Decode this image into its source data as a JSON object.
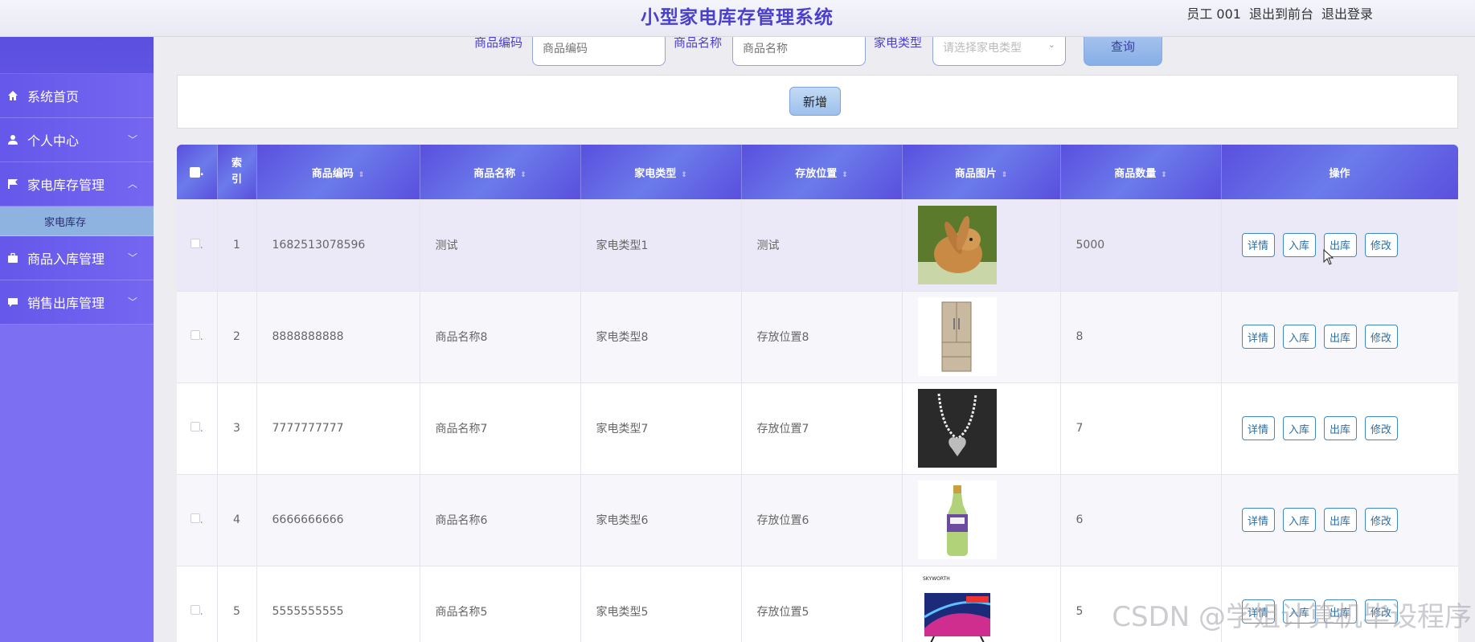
{
  "header": {
    "title": "小型家电库存管理系统",
    "user": "员工 001",
    "to_front": "退出到前台",
    "logout": "退出登录"
  },
  "sidebar": {
    "items": [
      {
        "label": "系统首页",
        "icon": "home-icon"
      },
      {
        "label": "个人中心",
        "icon": "user-icon"
      },
      {
        "label": "家电库存管理",
        "icon": "flag-icon"
      },
      {
        "label": "家电库存",
        "icon": ""
      },
      {
        "label": "商品入库管理",
        "icon": "briefcase-icon"
      },
      {
        "label": "销售出库管理",
        "icon": "chat-icon"
      }
    ]
  },
  "search": {
    "code_label": "商品编码",
    "code_placeholder": "商品编码",
    "name_label": "商品名称",
    "name_placeholder": "商品名称",
    "type_label": "家电类型",
    "type_placeholder": "请选择家电类型",
    "button": "查询"
  },
  "actions": {
    "add": "新增"
  },
  "table": {
    "headers": [
      "索引",
      "商品编码",
      "商品名称",
      "家电类型",
      "存放位置",
      "商品图片",
      "商品数量",
      "操作"
    ],
    "index_header": "索\n引",
    "rows": [
      {
        "idx": "1",
        "code": "1682513078596",
        "name": "测试",
        "type": "家电类型1",
        "location": "测试",
        "image": "rabbit",
        "qty": "5000"
      },
      {
        "idx": "2",
        "code": "8888888888",
        "name": "商品名称8",
        "type": "家电类型8",
        "location": "存放位置8",
        "image": "fridge",
        "qty": "8"
      },
      {
        "idx": "3",
        "code": "7777777777",
        "name": "商品名称7",
        "type": "家电类型7",
        "location": "存放位置7",
        "image": "necklace",
        "qty": "7"
      },
      {
        "idx": "4",
        "code": "6666666666",
        "name": "商品名称6",
        "type": "家电类型6",
        "location": "存放位置6",
        "image": "bottle",
        "qty": "6"
      },
      {
        "idx": "5",
        "code": "5555555555",
        "name": "商品名称5",
        "type": "家电类型5",
        "location": "存放位置5",
        "image": "tv",
        "qty": "5"
      }
    ],
    "ops": [
      "详情",
      "入库",
      "出库",
      "修改"
    ]
  },
  "watermark": "CSDN @学姐计算机毕设程序",
  "colors": {
    "accent": "#5a4fde",
    "sidebar": "#7d6ff2",
    "op_border": "#3d8ac6"
  }
}
